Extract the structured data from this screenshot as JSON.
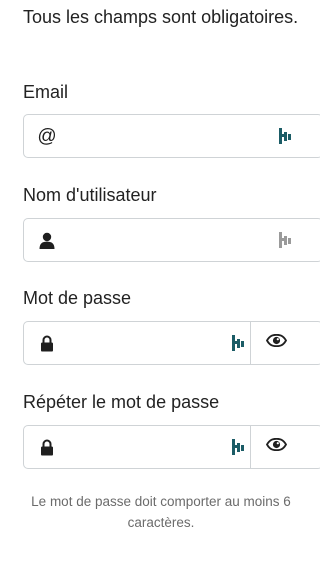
{
  "form": {
    "intro_text": "Tous les champs sont obligatoires.",
    "email": {
      "label": "Email",
      "leading_icon": "at-icon",
      "leading_glyph": "@",
      "value": "",
      "password_manager_icon_color": "#1b5c66"
    },
    "username": {
      "label": "Nom d'utilisateur",
      "leading_icon": "user-icon",
      "value": "",
      "password_manager_icon_color": "#9a9a9a"
    },
    "password": {
      "label": "Mot de passe",
      "leading_icon": "lock-icon",
      "value": "",
      "toggle_icon": "eye-icon",
      "password_manager_icon_color": "#1b5c66"
    },
    "password_repeat": {
      "label": "Répéter le mot de passe",
      "leading_icon": "lock-icon",
      "value": "",
      "toggle_icon": "eye-icon",
      "password_manager_icon_color": "#1b5c66"
    },
    "hint": "Le mot de passe doit comporter au moins 6 caractères."
  }
}
